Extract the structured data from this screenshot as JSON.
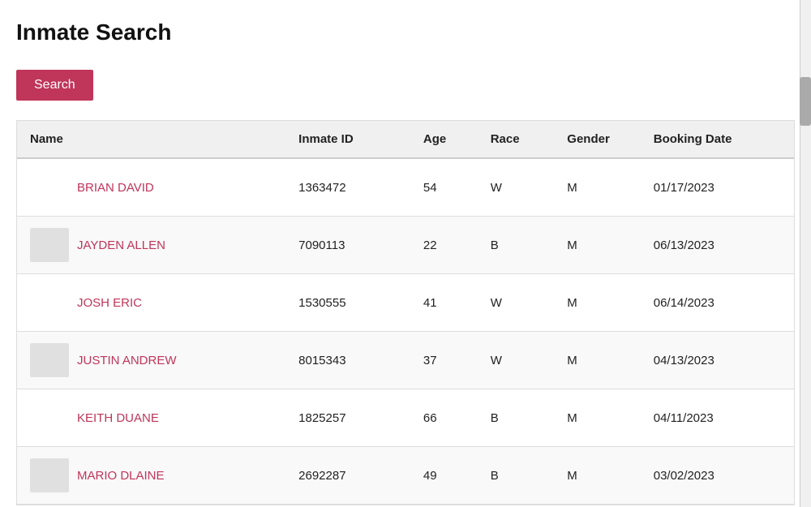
{
  "page": {
    "title": "Inmate Search"
  },
  "toolbar": {
    "search_label": "Search"
  },
  "table": {
    "columns": [
      {
        "key": "name",
        "label": "Name"
      },
      {
        "key": "inmate_id",
        "label": "Inmate ID"
      },
      {
        "key": "age",
        "label": "Age"
      },
      {
        "key": "race",
        "label": "Race"
      },
      {
        "key": "gender",
        "label": "Gender"
      },
      {
        "key": "booking_date",
        "label": "Booking Date"
      }
    ],
    "rows": [
      {
        "name": "BRIAN DAVID",
        "inmate_id": "1363472",
        "age": "54",
        "race": "W",
        "gender": "M",
        "booking_date": "01/17/2023",
        "has_avatar": false
      },
      {
        "name": "JAYDEN ALLEN",
        "inmate_id": "7090113",
        "age": "22",
        "race": "B",
        "gender": "M",
        "booking_date": "06/13/2023",
        "has_avatar": true
      },
      {
        "name": "JOSH ERIC",
        "inmate_id": "1530555",
        "age": "41",
        "race": "W",
        "gender": "M",
        "booking_date": "06/14/2023",
        "has_avatar": false
      },
      {
        "name": "JUSTIN ANDREW",
        "inmate_id": "8015343",
        "age": "37",
        "race": "W",
        "gender": "M",
        "booking_date": "04/13/2023",
        "has_avatar": true
      },
      {
        "name": "KEITH DUANE",
        "inmate_id": "1825257",
        "age": "66",
        "race": "B",
        "gender": "M",
        "booking_date": "04/11/2023",
        "has_avatar": false
      },
      {
        "name": "MARIO DLAINE",
        "inmate_id": "2692287",
        "age": "49",
        "race": "B",
        "gender": "M",
        "booking_date": "03/02/2023",
        "has_avatar": true
      }
    ]
  },
  "colors": {
    "accent": "#c0355a",
    "header_bg": "#f0f0f0",
    "even_row_bg": "#f9f9f9",
    "odd_row_bg": "#ffffff"
  }
}
